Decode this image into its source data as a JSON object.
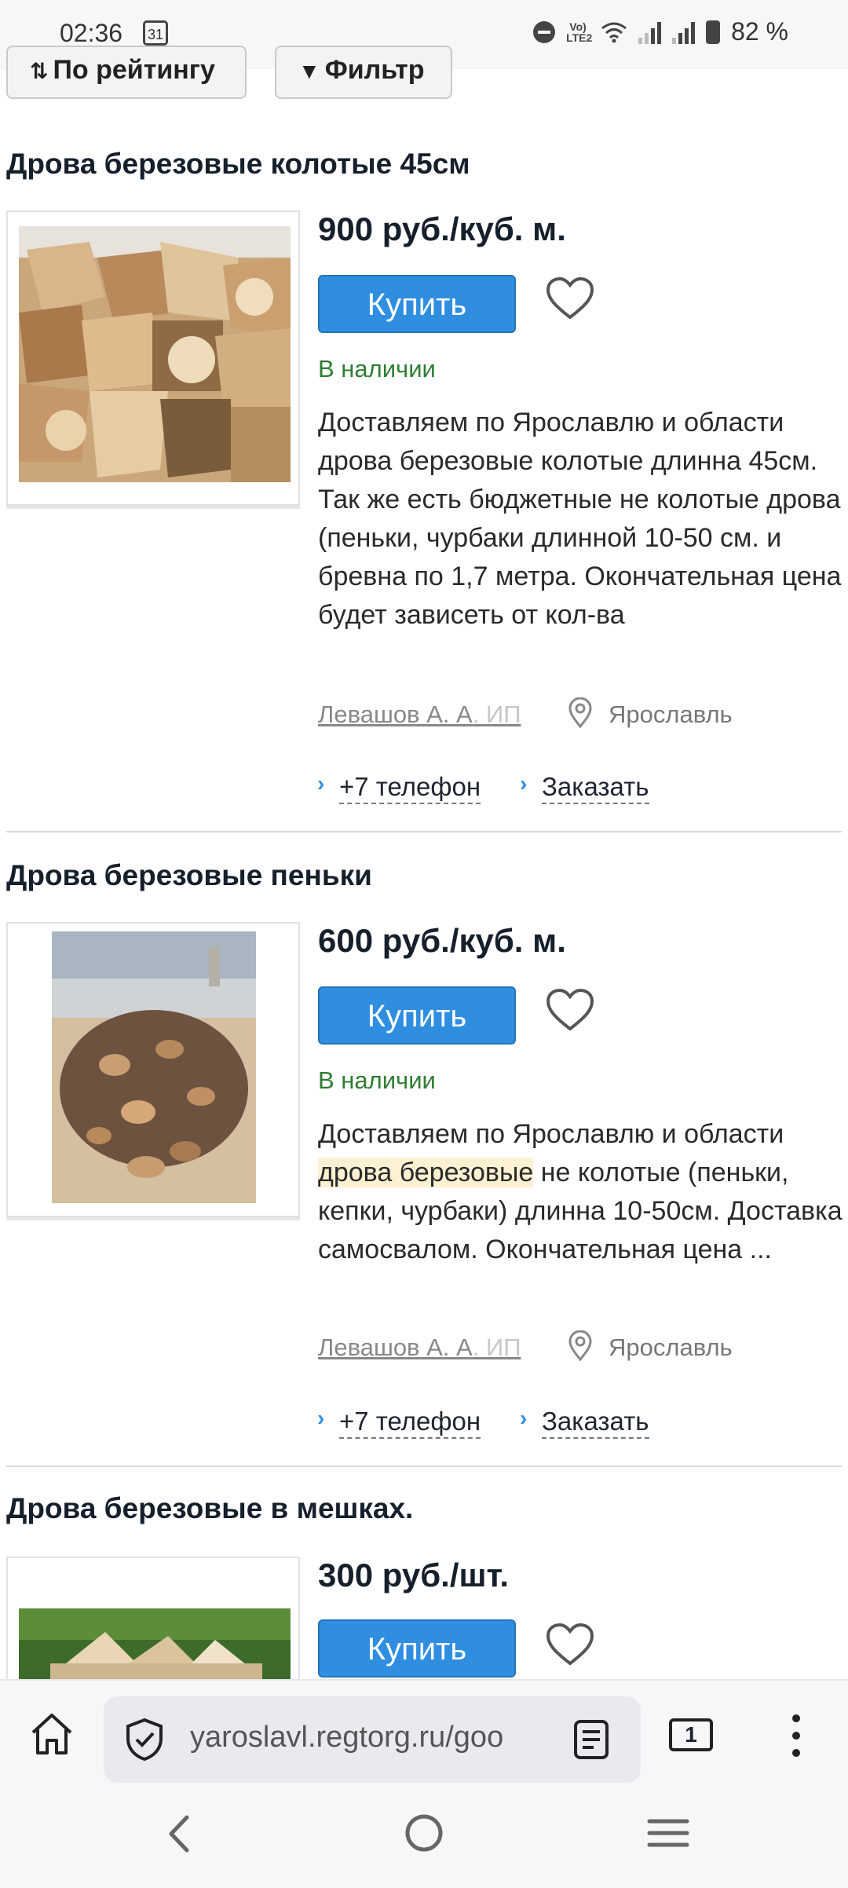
{
  "status_bar": {
    "time": "02:36",
    "calendar_day": "31",
    "network_label": "Vo) LTE2",
    "battery_percent": "82 %"
  },
  "toolbar": {
    "sort_label": "По рейтингу",
    "filter_label": "Фильтр"
  },
  "products": [
    {
      "title": "Дрова березовые колотые 45см",
      "price": "900 руб./куб. м.",
      "buy_label": "Купить",
      "stock": "В наличии",
      "description": "Доставляем по Ярославлю и области дрова березовые колотые длинна 45см. Так же есть бюджетные не колотые дрова (пеньки, чурбаки длинной 10-50 см. и бревна по 1,7 метра. Окончательная цена будет зависеть от кол-ва",
      "seller_main": "Левашов А. А",
      "seller_fade": ". ИП",
      "city": "Ярославль",
      "phone_label": "+7 телефон",
      "order_label": "Заказать"
    },
    {
      "title": "Дрова березовые пеньки",
      "price": "600 руб./куб. м.",
      "buy_label": "Купить",
      "stock": "В наличии",
      "description_pre": "Доставляем по Ярославлю и области ",
      "description_highlight": "дрова березовые",
      "description_post": " не колотые (пеньки, кепки, чурбаки) длинна 10-50см. Доставка самосвалом. Окончательная цена ...",
      "seller_main": "Левашов А. А",
      "seller_fade": ". ИП",
      "city": "Ярославль",
      "phone_label": "+7 телефон",
      "order_label": "Заказать"
    },
    {
      "title": "Дрова березовые в мешках.",
      "price": "300 руб./шт.",
      "buy_label": "Купить"
    }
  ],
  "browser": {
    "url": "yaroslavl.regtorg.ru/goo",
    "tab_count": "1"
  },
  "colors": {
    "buy_button": "#2f8ee0",
    "in_stock": "#2e7d32",
    "title_text": "#16202c"
  }
}
